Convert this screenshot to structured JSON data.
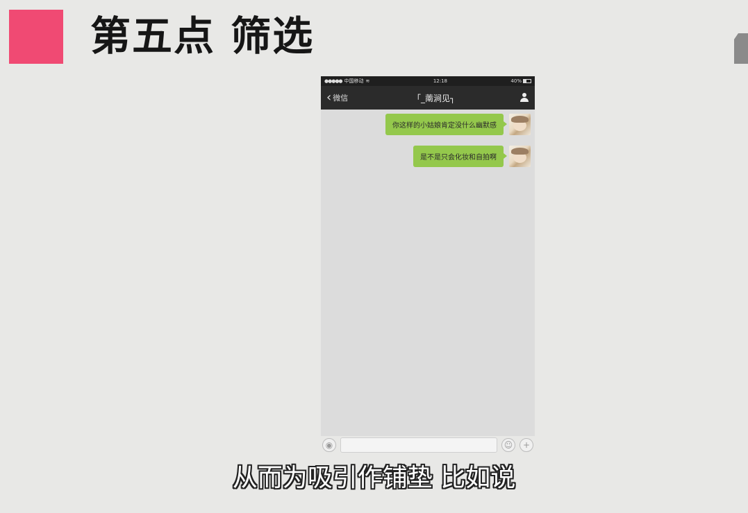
{
  "slide": {
    "title": "第五点 筛选",
    "accent_color": "#f04a73",
    "subtitle": "从而为吸引作铺垫 比如说"
  },
  "phone": {
    "status_bar": {
      "carrier": "中国移动",
      "time": "12:18",
      "battery": "40%"
    },
    "nav": {
      "back_label": "微信",
      "chat_title": "「_萳涧见┐"
    },
    "messages": [
      {
        "text": "你这样的小姑娘肯定没什么幽默感",
        "side": "right"
      },
      {
        "text": "是不是只会化妆和自拍啊",
        "side": "right"
      }
    ],
    "bubble_color": "#94c84c",
    "input_bar": {
      "voice_icon": "voice-icon",
      "emoji_icon": "emoji-icon",
      "plus_icon": "plus-icon"
    }
  }
}
